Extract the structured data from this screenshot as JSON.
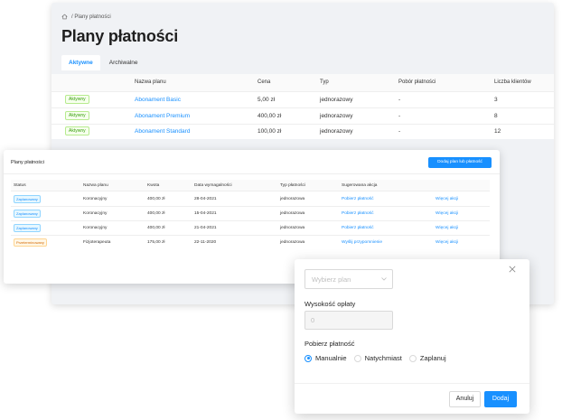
{
  "background_window": {
    "breadcrumb": "/ Plany płatności",
    "title": "Plany płatności",
    "tabs": [
      {
        "label": "Aktywne",
        "active": true
      },
      {
        "label": "Archiwalne",
        "active": false
      }
    ],
    "table": {
      "headers": [
        "",
        "Nazwa planu",
        "Cena",
        "Typ",
        "Pobór płatności",
        "Liczba klientów"
      ],
      "rows": [
        {
          "status": "Aktywny",
          "name": "Abonament Basic",
          "price": "5,00 zł",
          "type": "jednorazowy",
          "collection": "-",
          "clients": "3"
        },
        {
          "status": "Aktywny",
          "name": "Abonament Premium",
          "price": "400,00 zł",
          "type": "jednorazowy",
          "collection": "-",
          "clients": "8"
        },
        {
          "status": "Aktywny",
          "name": "Abonament Standard",
          "price": "100,00 zł",
          "type": "jednorazowy",
          "collection": "-",
          "clients": "12"
        }
      ]
    }
  },
  "middle_window": {
    "title": "Plany płatności",
    "add_button": "Dodaj plan lub płatność",
    "table": {
      "headers": [
        "Status",
        "Nazwa planu",
        "Kwota",
        "Data wymagalności",
        "Typ płatności",
        "Sugerowana akcja",
        ""
      ],
      "rows": [
        {
          "status": "Zaplanowany",
          "status_kind": "blue",
          "name": "Koronacyjny",
          "amount": "400,00 zł",
          "due": "28-04-2021",
          "ptype": "jednorazowa",
          "action": "Pobierz płatność",
          "more": "Więcej akcji"
        },
        {
          "status": "Zaplanowany",
          "status_kind": "blue",
          "name": "Koronacyjny",
          "amount": "400,00 zł",
          "due": "15-04-2021",
          "ptype": "jednorazowa",
          "action": "Pobierz płatność",
          "more": "Więcej akcji"
        },
        {
          "status": "Zaplanowany",
          "status_kind": "blue",
          "name": "Koronacyjny",
          "amount": "400,00 zł",
          "due": "21-04-2021",
          "ptype": "jednorazowa",
          "action": "Pobierz płatność",
          "more": "Więcej akcji"
        },
        {
          "status": "Przeterminowany",
          "status_kind": "orange",
          "name": "Fizjoterapeuta",
          "amount": "175,00 zł",
          "due": "22-11-2020",
          "ptype": "jednorazowa",
          "action": "Wyślij przypomnienie",
          "more": "Więcej akcji"
        }
      ]
    }
  },
  "modal": {
    "select_placeholder": "Wybierz plan",
    "fee_label": "Wysokość opłaty",
    "fee_value": "0",
    "collect_label": "Pobierz płatność",
    "radios": [
      {
        "label": "Manualnie",
        "checked": true
      },
      {
        "label": "Natychmiast",
        "checked": false
      },
      {
        "label": "Zaplanuj",
        "checked": false
      }
    ],
    "cancel_label": "Anuluj",
    "submit_label": "Dodaj"
  }
}
